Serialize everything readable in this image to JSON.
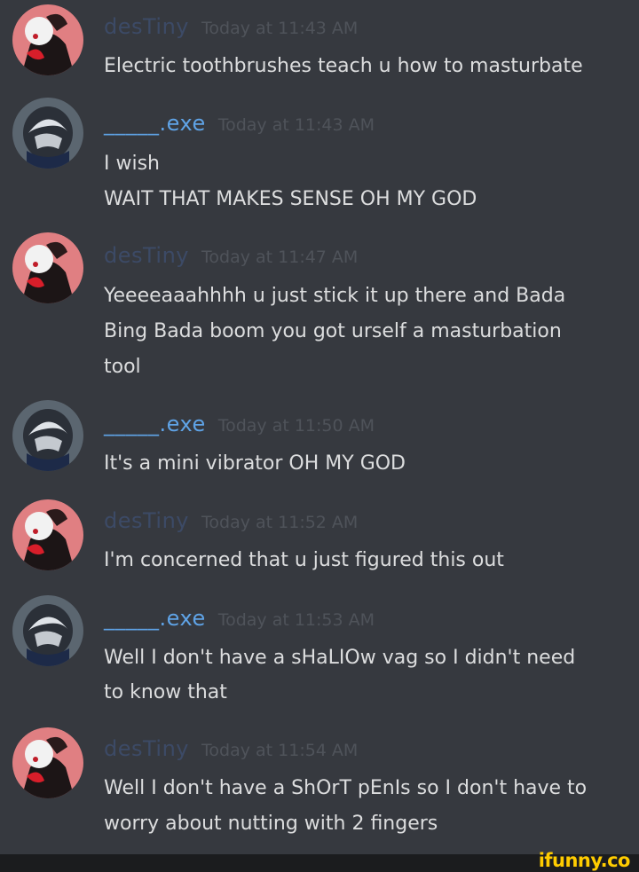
{
  "colors": {
    "background": "#36393f",
    "message_text": "#dcddde",
    "timestamp": "#4f535a",
    "user_destiny": "#3c4a66",
    "user_exe": "#5fa3e6",
    "footer": "#1b1c1e",
    "watermark": "#ffcc00"
  },
  "messages": [
    {
      "user": "desTiny",
      "timestamp": "Today at 11:43 AM",
      "avatar": "destiny-avatar",
      "lines": [
        "Electric toothbrushes teach u how to masturbate"
      ]
    },
    {
      "user": "_____.exe",
      "timestamp": "Today at 11:43 AM",
      "avatar": "exe-avatar",
      "lines": [
        "I wish",
        "WAIT THAT MAKES SENSE OH MY GOD"
      ]
    },
    {
      "user": "desTiny",
      "timestamp": "Today at 11:47 AM",
      "avatar": "destiny-avatar",
      "lines": [
        "Yeeeeaaahhhh u just stick it up there and Bada",
        "Bing Bada boom you got urself a masturbation",
        "tool"
      ]
    },
    {
      "user": "_____.exe",
      "timestamp": "Today at 11:50 AM",
      "avatar": "exe-avatar",
      "lines": [
        "It's a mini vibrator OH MY GOD"
      ]
    },
    {
      "user": "desTiny",
      "timestamp": "Today at 11:52 AM",
      "avatar": "destiny-avatar",
      "lines": [
        "I'm concerned that u just figured this out"
      ]
    },
    {
      "user": "_____.exe",
      "timestamp": "Today at 11:53 AM",
      "avatar": "exe-avatar",
      "lines": [
        "Well I don't have a sHaLIOw vag so I didn't need",
        "to know that"
      ]
    },
    {
      "user": "desTiny",
      "timestamp": "Today at 11:54 AM",
      "avatar": "destiny-avatar",
      "lines": [
        "Well I don't have a ShOrT pEnIs so I don't have to",
        "worry about nutting with 2 fingers"
      ]
    }
  ],
  "watermark": "ifunny.co"
}
